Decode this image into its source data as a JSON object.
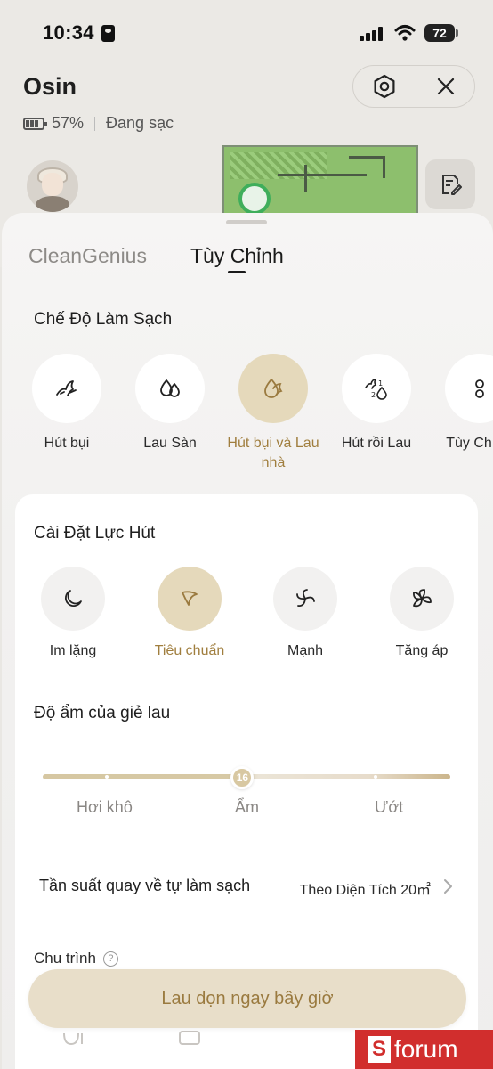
{
  "status_bar": {
    "time": "10:34",
    "battery": "72"
  },
  "header": {
    "robot_name": "Osin",
    "battery_percent": "57%",
    "charging_status": "Đang sạc"
  },
  "tabs": [
    {
      "label": "CleanGenius",
      "active": false
    },
    {
      "label": "Tùy Chỉnh",
      "active": true
    }
  ],
  "cleaning_mode": {
    "title": "Chế Độ Làm Sạch",
    "modes": [
      {
        "label": "Hút bụi",
        "icon": "vacuum-icon",
        "active": false
      },
      {
        "label": "Lau Sàn",
        "icon": "mop-drops-icon",
        "active": false
      },
      {
        "label": "Hút bụi và Lau nhà",
        "icon": "vacuum-mop-icon",
        "active": true
      },
      {
        "label": "Hút rồi Lau",
        "icon": "vacuum-then-mop-icon",
        "active": false
      },
      {
        "label": "Tùy Ch Sạ",
        "icon": "custom-mode-icon",
        "active": false
      }
    ]
  },
  "suction": {
    "title": "Cài Đặt Lực Hút",
    "levels": [
      {
        "label": "Im lặng",
        "icon": "moon-icon",
        "active": false
      },
      {
        "label": "Tiêu chuẩn",
        "icon": "fan-standard-icon",
        "active": true
      },
      {
        "label": "Mạnh",
        "icon": "fan-strong-icon",
        "active": false
      },
      {
        "label": "Tăng áp",
        "icon": "fan-turbo-icon",
        "active": false
      }
    ]
  },
  "mop_humidity": {
    "title": "Độ ẩm của giẻ lau",
    "value": "16",
    "value_fraction": 0.49,
    "labels": [
      "Hơi khô",
      "Ẩm",
      "Ướt"
    ]
  },
  "self_clean": {
    "label": "Tần suất quay về tự làm sạch",
    "value": "Theo Diện Tích 20㎡"
  },
  "cycle": {
    "label": "Chu trình",
    "help": "?"
  },
  "cta": {
    "label": "Lau dọn ngay bây giờ"
  },
  "watermark": {
    "brand": "forum",
    "logo_letter": "S"
  },
  "colors": {
    "accent": "#a07e3e",
    "accent_bg": "#e5d9bb",
    "cta_bg": "#e8dec9"
  }
}
